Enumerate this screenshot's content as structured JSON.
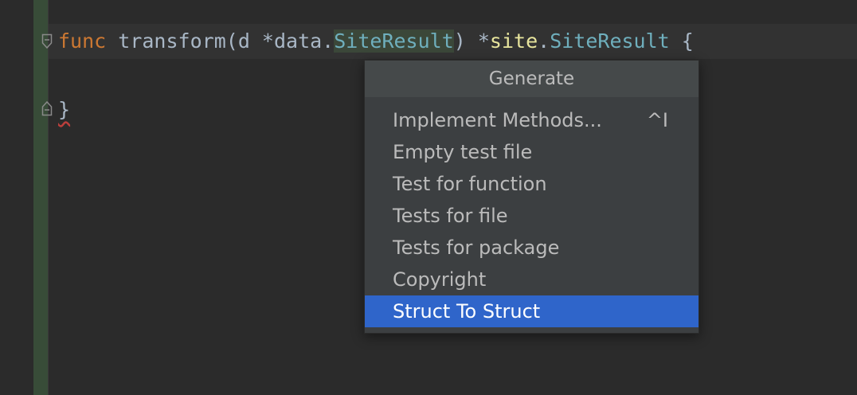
{
  "editor": {
    "line1": {
      "keyword": "func",
      "name": "transform",
      "open_paren": "(",
      "param": "d *",
      "param_pkg": "data.",
      "param_type": "SiteResult",
      "close_paren": ")",
      "ret_star": " *",
      "ret_pkg": "site",
      "ret_dot": ".",
      "ret_type": "SiteResult",
      "brace_open": " {"
    },
    "line3": {
      "brace_close": "}"
    }
  },
  "popup": {
    "title": "Generate",
    "items": [
      {
        "label": "Implement Methods...",
        "shortcut": "^I"
      },
      {
        "label": "Empty test file"
      },
      {
        "label": "Test for function"
      },
      {
        "label": "Tests for file"
      },
      {
        "label": "Tests for package"
      },
      {
        "label": "Copyright"
      },
      {
        "label": "Struct To Struct",
        "selected": true
      }
    ]
  },
  "colors": {
    "background": "#2b2b2b",
    "keyword": "#cc7832",
    "type": "#6fafbd",
    "package": "#e8e59d",
    "selection": "#2f65ca"
  }
}
